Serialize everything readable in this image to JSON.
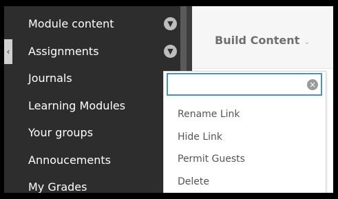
{
  "sidebar": {
    "items": [
      {
        "label": "Module content",
        "has_expand": true
      },
      {
        "label": "Assignments",
        "has_expand": true
      },
      {
        "label": "Journals",
        "has_expand": false
      },
      {
        "label": "Learning Modules",
        "has_expand": false
      },
      {
        "label": "Your groups",
        "has_expand": false
      },
      {
        "label": "Annoucements",
        "has_expand": false
      },
      {
        "label": "My Grades",
        "has_expand": false
      }
    ],
    "expand_icon": "chevron-down-icon",
    "collapse_icon": "chevron-left-icon"
  },
  "toolbar": {
    "build_content_label": "Build Content",
    "build_content_icon": "chevron-down-icon"
  },
  "context_menu": {
    "search_value": "",
    "clear_icon": "clear-circle-icon",
    "items": [
      "Rename Link",
      "Hide Link",
      "Permit Guests",
      "Delete"
    ]
  },
  "colors": {
    "sidebar_bg": "#2d2d2d",
    "focus_border": "#4a90c2"
  }
}
